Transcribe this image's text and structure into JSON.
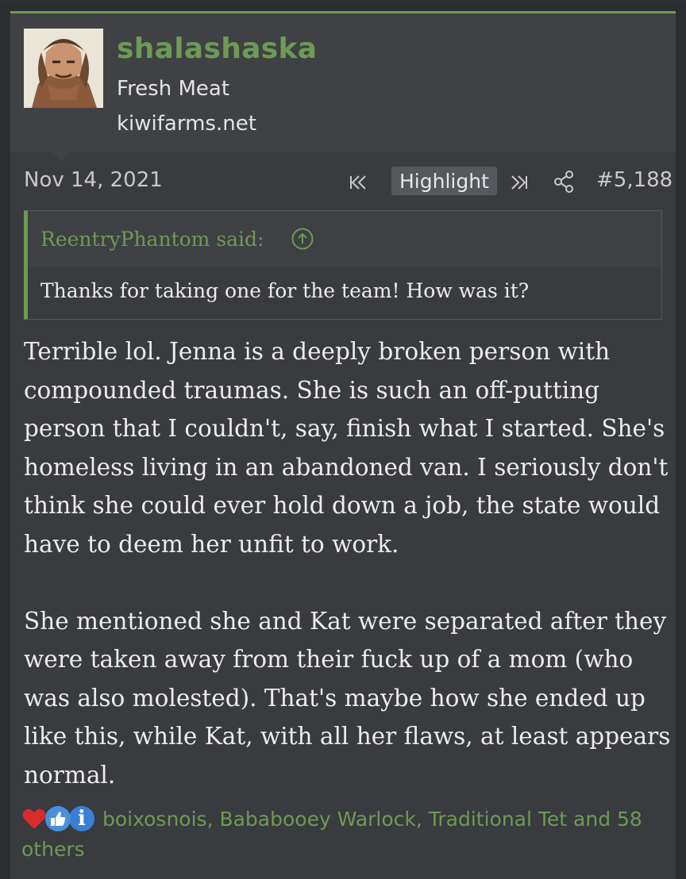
{
  "user": {
    "name": "shalashaska",
    "title": "Fresh Meat",
    "site": "kiwifarms.net",
    "avatar_icon": "avatar-portrait"
  },
  "meta": {
    "date": "Nov 14, 2021",
    "highlight_label": "Highlight",
    "post_number": "#5,188",
    "prev_icon": "double-chevron-left-icon",
    "next_icon": "double-chevron-right-icon",
    "share_icon": "share-icon"
  },
  "quote": {
    "author": "ReentryPhantom said:",
    "text": "Thanks for taking one for the team! How was it?"
  },
  "body": {
    "paragraph1": "Terrible lol. Jenna is a deeply broken person with compounded traumas. She is such an off-putting person that I couldn't, say, finish what I started. She's homeless living in an abandoned van. I seriously don't think she could ever hold down a job, the state would have to deem her unfit to work.",
    "paragraph2": "She mentioned she and Kat were separated after they were taken away from their fuck up of a mom (who was also molested). That's maybe how she ended up like this, while Kat, with all her flaws, at least appears normal."
  },
  "reactions": {
    "text": "boixosnois, Bababooey Warlock, Traditional Tet and 58 others",
    "info_glyph": "i"
  },
  "colors": {
    "accent": "#6e9a55",
    "background": "#393b3f",
    "text": "#ececec"
  }
}
